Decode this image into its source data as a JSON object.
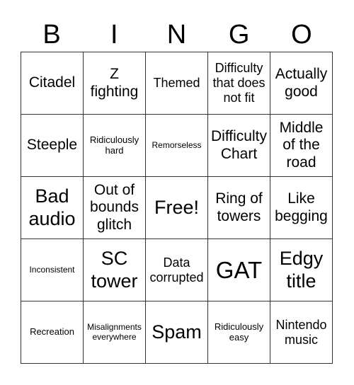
{
  "header": [
    "B",
    "I",
    "N",
    "G",
    "O"
  ],
  "cells": [
    [
      "Citadel",
      "Z fighting",
      "Themed",
      "Difficulty that does not fit",
      "Actually good"
    ],
    [
      "Steeple",
      "Ridiculously hard",
      "Remorseless",
      "Difficulty Chart",
      "Middle of the road"
    ],
    [
      "Bad audio",
      "Out of bounds glitch",
      "Free!",
      "Ring of towers",
      "Like begging"
    ],
    [
      "Inconsistent",
      "SC tower",
      "Data corrupted",
      "GAT",
      "Edgy title"
    ],
    [
      "Recreation",
      "Misalignments everywhere",
      "Spam",
      "Ridiculously easy",
      "Nintendo music"
    ]
  ]
}
